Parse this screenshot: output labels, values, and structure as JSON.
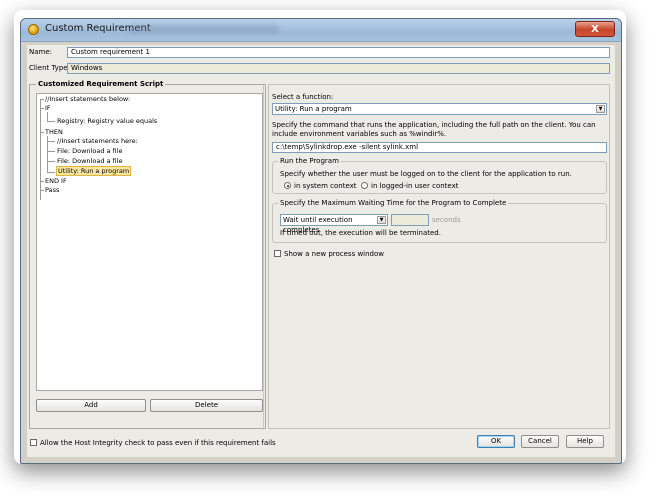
{
  "window": {
    "title": "Custom Requirement",
    "close_glyph": "X"
  },
  "name_field": {
    "label": "Name:",
    "value": "Custom requirement 1"
  },
  "client_type": {
    "label": "Client Type:",
    "value": "Windows"
  },
  "script_pane": {
    "title": "Customized Requirement Script",
    "tree": [
      "//Insert statements below:",
      "IF",
      "Registry: Registry value equals",
      "THEN",
      "//Insert statements here:",
      "File: Download a file",
      "File: Download a file",
      "Utility: Run a program",
      "END IF",
      "Pass"
    ],
    "add_label": "Add",
    "delete_label": "Delete"
  },
  "function_panel": {
    "select_label": "Select a function:",
    "selected_function": "Utility: Run a program",
    "command_help": "Specify the command that runs the application, including the full path on the client. You can include environment variables such as %windir%.",
    "command_value": "c:\\temp\\Sylinkdrop.exe -silent sylink.xml",
    "run_group": {
      "title": "Run the Program",
      "help": "Specify whether the user must be logged on to the client for the application to run.",
      "option_system": "in system context",
      "option_user": "in logged-in user context"
    },
    "wait_group": {
      "title": "Specify the Maximum Waiting Time for the Program to Complete",
      "wait_selected": "Wait until execution completes",
      "seconds_label": "seconds",
      "timeout_note": "If timed out, the execution will be terminated."
    },
    "new_window_label": "Show a new process window"
  },
  "footer": {
    "integrity_label": "Allow the Host Integrity check to pass even if this requirement fails",
    "ok": "OK",
    "cancel": "Cancel",
    "help": "Help"
  },
  "colors": {
    "title_bar": "#a7c2df",
    "selection": "#fbe6a0",
    "close": "#c7442a"
  },
  "icons": [
    "app-shield-icon",
    "close-icon",
    "chevron-down-icon"
  ]
}
